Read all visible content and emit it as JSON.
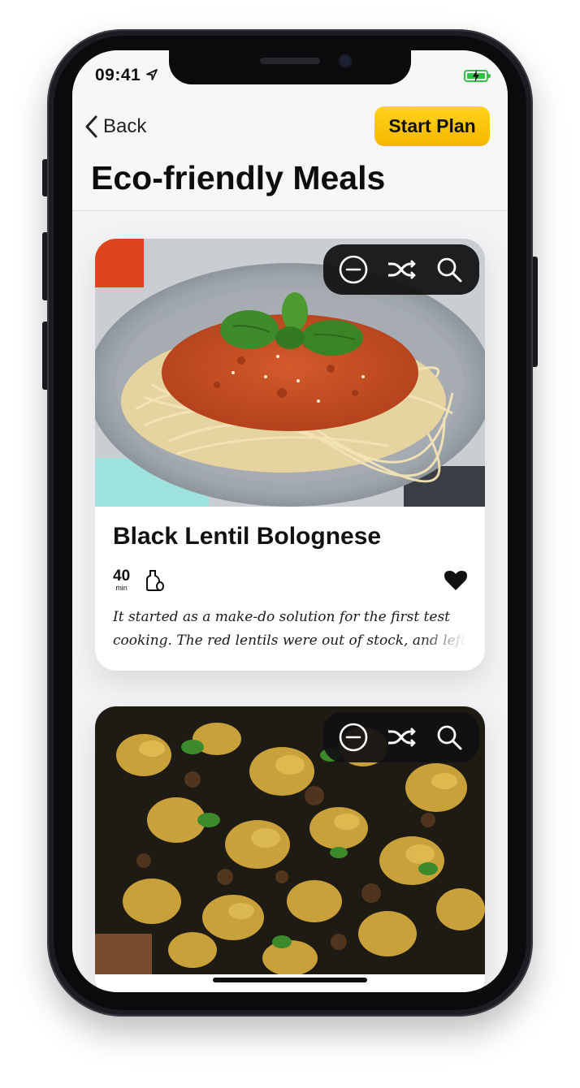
{
  "status_bar": {
    "time": "09:41",
    "battery_color": "#31c24a",
    "icons": [
      "location-arrow-icon",
      "battery-icon"
    ]
  },
  "nav": {
    "back_label": "Back",
    "start_plan_label": "Start Plan",
    "start_plan_color": "#f9c40b"
  },
  "page": {
    "title": "Eco-friendly Meals"
  },
  "toolbar_icons": [
    "minus-circle-icon",
    "shuffle-icon",
    "search-icon"
  ],
  "meals": [
    {
      "title": "Black Lentil Bolognese",
      "time_value": "40",
      "time_unit": "min",
      "favorite": true,
      "description": "It started as a make-do solution for the first test cooking. The red lentils were out of stock, and left w",
      "image": "spaghetti-bolognese-photo"
    },
    {
      "image": "curried-potato-cauliflower-photo"
    }
  ]
}
